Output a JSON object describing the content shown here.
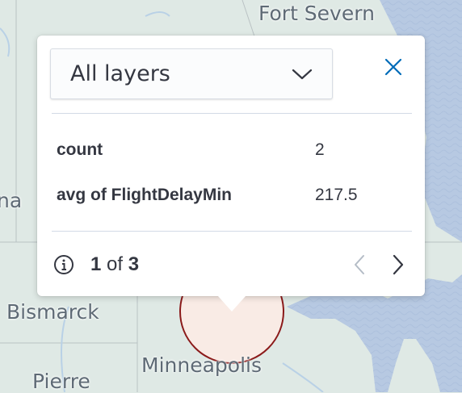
{
  "map": {
    "places": {
      "fort_severn": "Fort Severn",
      "bismarck": "Bismarck",
      "minneapolis": "Minneapolis",
      "pierre": "Pierre",
      "partial_left": "na"
    },
    "colors": {
      "land": "#dfe9e5",
      "water": "#b7c9e2",
      "cluster_fill": "#f9ebe5",
      "cluster_stroke": "#8b1a1a"
    }
  },
  "popup": {
    "layer_select": {
      "selected": "All layers",
      "icon": "chevron-down-icon"
    },
    "close_icon": "close-icon",
    "properties": [
      {
        "key": "count",
        "value": "2"
      },
      {
        "key": "avg of FlightDelayMin",
        "value": "217.5"
      }
    ],
    "footer": {
      "info_icon": "info-icon",
      "page_current": "1",
      "page_of": "of",
      "page_total": "3",
      "prev_icon": "chevron-left-icon",
      "next_icon": "chevron-right-icon"
    }
  }
}
